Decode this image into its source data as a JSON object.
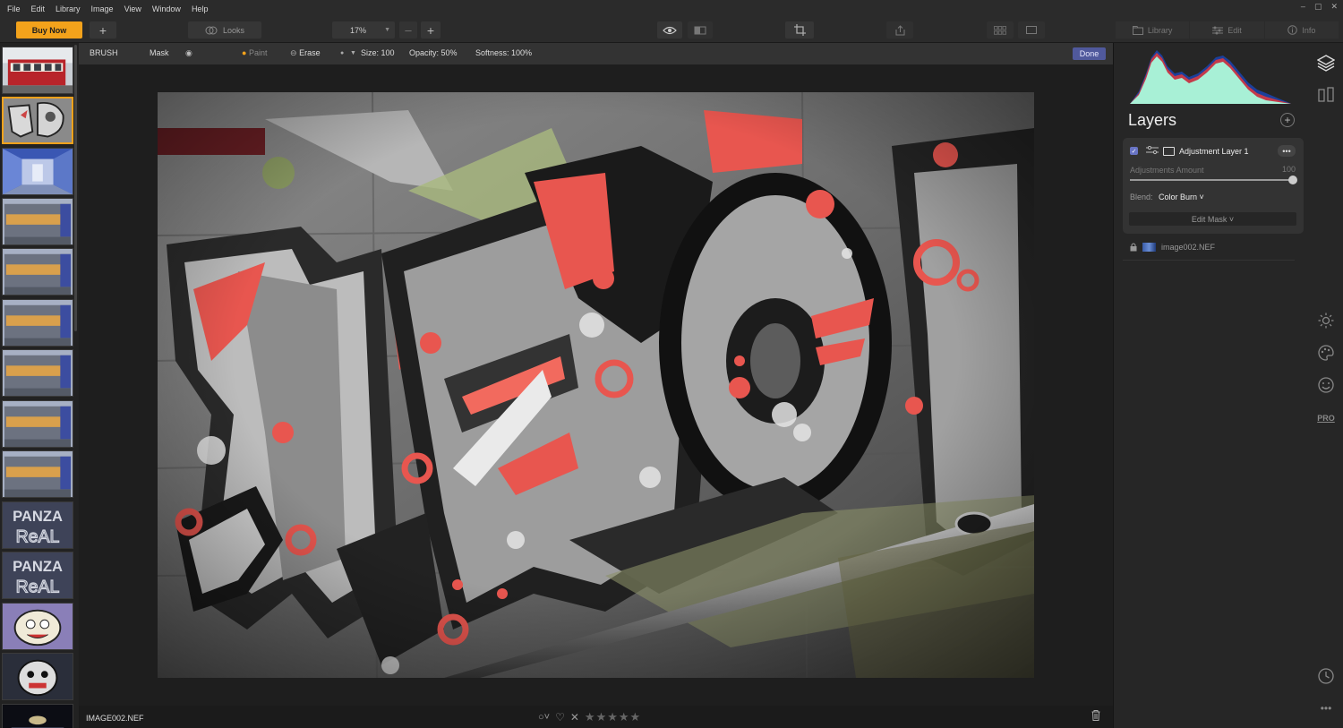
{
  "menu": [
    "File",
    "Edit",
    "Library",
    "Image",
    "View",
    "Window",
    "Help"
  ],
  "window_controls": [
    "–",
    "▢",
    "✕"
  ],
  "toolbar": {
    "buy_now": "Buy Now",
    "add": "+",
    "looks": "Looks",
    "zoom": "17%",
    "zoom_out": "–",
    "zoom_in": "+"
  },
  "modes": [
    {
      "label": "Library",
      "icon": "library-icon"
    },
    {
      "label": "Edit",
      "icon": "sliders-icon"
    },
    {
      "label": "Info",
      "icon": "info-icon"
    }
  ],
  "brush": {
    "tool": "BRUSH",
    "mask": "Mask",
    "paint": "Paint",
    "erase": "Erase",
    "size": "Size: 100",
    "opacity": "Opacity: 50%",
    "softness": "Softness: 100%",
    "done": "Done"
  },
  "filmstrip": {
    "selected_index": 1,
    "thumbs": [
      "tram",
      "graffiti-ho",
      "room",
      "building",
      "building",
      "building",
      "building",
      "building",
      "building",
      "panza-real",
      "panza-real",
      "cartoon",
      "cartoon-face",
      "night"
    ],
    "text_panza": [
      "PANZA",
      "ReAL"
    ]
  },
  "layers": {
    "title": "Layers",
    "add": "+",
    "adjustment_layer": {
      "checked": true,
      "name": "Adjustment Layer 1",
      "more": "•••",
      "amount_label": "Adjustments Amount",
      "amount_value": "100",
      "amount": 100,
      "blend_label": "Blend:",
      "blend_value": "Color Burn ˅",
      "edit_mask": "Edit Mask ˅"
    },
    "base_layer": {
      "name": "image002.NEF"
    }
  },
  "rail": {
    "pro": "PRO"
  },
  "bottom": {
    "filename": "IMAGE002.NEF",
    "stars": [
      "★",
      "★",
      "★",
      "★",
      "★"
    ],
    "reject": "✕"
  },
  "colors": {
    "accent": "#f3a21b",
    "done": "#50599c",
    "graffiti_red": "#e8564f",
    "histogram": "#a8f0d6"
  }
}
